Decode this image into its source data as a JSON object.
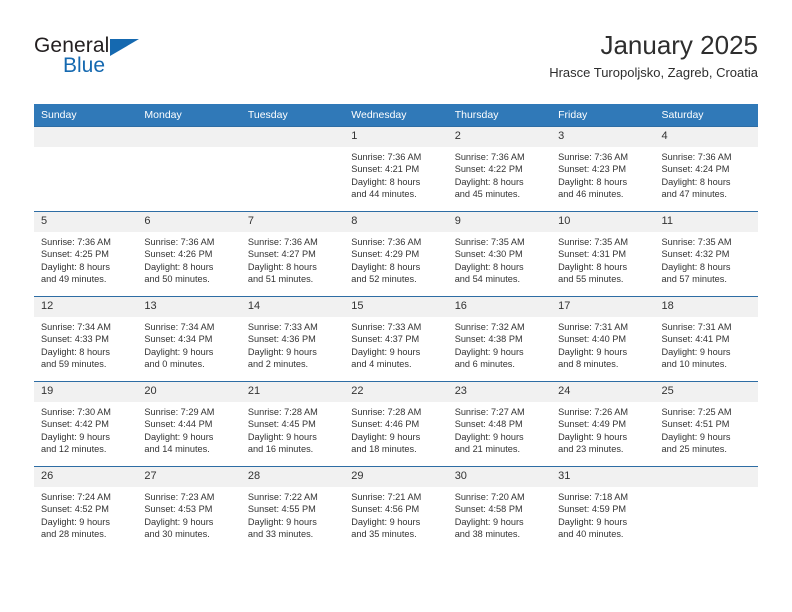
{
  "brand": {
    "name_part1": "General",
    "name_part2": "Blue",
    "triangle_color": "#1569b0"
  },
  "header": {
    "title": "January 2025",
    "subtitle": "Hrasce Turopoljsko, Zagreb, Croatia"
  },
  "theme": {
    "header_row_bg": "#3079b8",
    "header_row_text": "#ffffff",
    "daynum_bg": "#f1f1f1",
    "cell_border": "#2e6da4"
  },
  "weekdays": [
    "Sunday",
    "Monday",
    "Tuesday",
    "Wednesday",
    "Thursday",
    "Friday",
    "Saturday"
  ],
  "labels": {
    "sunrise_prefix": "Sunrise:",
    "sunset_prefix": "Sunset:",
    "daylight_prefix": "Daylight:"
  },
  "weeks": [
    [
      {
        "day": "",
        "empty": true
      },
      {
        "day": "",
        "empty": true
      },
      {
        "day": "",
        "empty": true
      },
      {
        "day": "1",
        "sunrise": "Sunrise: 7:36 AM",
        "sunset": "Sunset: 4:21 PM",
        "daylight1": "Daylight: 8 hours",
        "daylight2": "and 44 minutes."
      },
      {
        "day": "2",
        "sunrise": "Sunrise: 7:36 AM",
        "sunset": "Sunset: 4:22 PM",
        "daylight1": "Daylight: 8 hours",
        "daylight2": "and 45 minutes."
      },
      {
        "day": "3",
        "sunrise": "Sunrise: 7:36 AM",
        "sunset": "Sunset: 4:23 PM",
        "daylight1": "Daylight: 8 hours",
        "daylight2": "and 46 minutes."
      },
      {
        "day": "4",
        "sunrise": "Sunrise: 7:36 AM",
        "sunset": "Sunset: 4:24 PM",
        "daylight1": "Daylight: 8 hours",
        "daylight2": "and 47 minutes."
      }
    ],
    [
      {
        "day": "5",
        "sunrise": "Sunrise: 7:36 AM",
        "sunset": "Sunset: 4:25 PM",
        "daylight1": "Daylight: 8 hours",
        "daylight2": "and 49 minutes."
      },
      {
        "day": "6",
        "sunrise": "Sunrise: 7:36 AM",
        "sunset": "Sunset: 4:26 PM",
        "daylight1": "Daylight: 8 hours",
        "daylight2": "and 50 minutes."
      },
      {
        "day": "7",
        "sunrise": "Sunrise: 7:36 AM",
        "sunset": "Sunset: 4:27 PM",
        "daylight1": "Daylight: 8 hours",
        "daylight2": "and 51 minutes."
      },
      {
        "day": "8",
        "sunrise": "Sunrise: 7:36 AM",
        "sunset": "Sunset: 4:29 PM",
        "daylight1": "Daylight: 8 hours",
        "daylight2": "and 52 minutes."
      },
      {
        "day": "9",
        "sunrise": "Sunrise: 7:35 AM",
        "sunset": "Sunset: 4:30 PM",
        "daylight1": "Daylight: 8 hours",
        "daylight2": "and 54 minutes."
      },
      {
        "day": "10",
        "sunrise": "Sunrise: 7:35 AM",
        "sunset": "Sunset: 4:31 PM",
        "daylight1": "Daylight: 8 hours",
        "daylight2": "and 55 minutes."
      },
      {
        "day": "11",
        "sunrise": "Sunrise: 7:35 AM",
        "sunset": "Sunset: 4:32 PM",
        "daylight1": "Daylight: 8 hours",
        "daylight2": "and 57 minutes."
      }
    ],
    [
      {
        "day": "12",
        "sunrise": "Sunrise: 7:34 AM",
        "sunset": "Sunset: 4:33 PM",
        "daylight1": "Daylight: 8 hours",
        "daylight2": "and 59 minutes."
      },
      {
        "day": "13",
        "sunrise": "Sunrise: 7:34 AM",
        "sunset": "Sunset: 4:34 PM",
        "daylight1": "Daylight: 9 hours",
        "daylight2": "and 0 minutes."
      },
      {
        "day": "14",
        "sunrise": "Sunrise: 7:33 AM",
        "sunset": "Sunset: 4:36 PM",
        "daylight1": "Daylight: 9 hours",
        "daylight2": "and 2 minutes."
      },
      {
        "day": "15",
        "sunrise": "Sunrise: 7:33 AM",
        "sunset": "Sunset: 4:37 PM",
        "daylight1": "Daylight: 9 hours",
        "daylight2": "and 4 minutes."
      },
      {
        "day": "16",
        "sunrise": "Sunrise: 7:32 AM",
        "sunset": "Sunset: 4:38 PM",
        "daylight1": "Daylight: 9 hours",
        "daylight2": "and 6 minutes."
      },
      {
        "day": "17",
        "sunrise": "Sunrise: 7:31 AM",
        "sunset": "Sunset: 4:40 PM",
        "daylight1": "Daylight: 9 hours",
        "daylight2": "and 8 minutes."
      },
      {
        "day": "18",
        "sunrise": "Sunrise: 7:31 AM",
        "sunset": "Sunset: 4:41 PM",
        "daylight1": "Daylight: 9 hours",
        "daylight2": "and 10 minutes."
      }
    ],
    [
      {
        "day": "19",
        "sunrise": "Sunrise: 7:30 AM",
        "sunset": "Sunset: 4:42 PM",
        "daylight1": "Daylight: 9 hours",
        "daylight2": "and 12 minutes."
      },
      {
        "day": "20",
        "sunrise": "Sunrise: 7:29 AM",
        "sunset": "Sunset: 4:44 PM",
        "daylight1": "Daylight: 9 hours",
        "daylight2": "and 14 minutes."
      },
      {
        "day": "21",
        "sunrise": "Sunrise: 7:28 AM",
        "sunset": "Sunset: 4:45 PM",
        "daylight1": "Daylight: 9 hours",
        "daylight2": "and 16 minutes."
      },
      {
        "day": "22",
        "sunrise": "Sunrise: 7:28 AM",
        "sunset": "Sunset: 4:46 PM",
        "daylight1": "Daylight: 9 hours",
        "daylight2": "and 18 minutes."
      },
      {
        "day": "23",
        "sunrise": "Sunrise: 7:27 AM",
        "sunset": "Sunset: 4:48 PM",
        "daylight1": "Daylight: 9 hours",
        "daylight2": "and 21 minutes."
      },
      {
        "day": "24",
        "sunrise": "Sunrise: 7:26 AM",
        "sunset": "Sunset: 4:49 PM",
        "daylight1": "Daylight: 9 hours",
        "daylight2": "and 23 minutes."
      },
      {
        "day": "25",
        "sunrise": "Sunrise: 7:25 AM",
        "sunset": "Sunset: 4:51 PM",
        "daylight1": "Daylight: 9 hours",
        "daylight2": "and 25 minutes."
      }
    ],
    [
      {
        "day": "26",
        "sunrise": "Sunrise: 7:24 AM",
        "sunset": "Sunset: 4:52 PM",
        "daylight1": "Daylight: 9 hours",
        "daylight2": "and 28 minutes."
      },
      {
        "day": "27",
        "sunrise": "Sunrise: 7:23 AM",
        "sunset": "Sunset: 4:53 PM",
        "daylight1": "Daylight: 9 hours",
        "daylight2": "and 30 minutes."
      },
      {
        "day": "28",
        "sunrise": "Sunrise: 7:22 AM",
        "sunset": "Sunset: 4:55 PM",
        "daylight1": "Daylight: 9 hours",
        "daylight2": "and 33 minutes."
      },
      {
        "day": "29",
        "sunrise": "Sunrise: 7:21 AM",
        "sunset": "Sunset: 4:56 PM",
        "daylight1": "Daylight: 9 hours",
        "daylight2": "and 35 minutes."
      },
      {
        "day": "30",
        "sunrise": "Sunrise: 7:20 AM",
        "sunset": "Sunset: 4:58 PM",
        "daylight1": "Daylight: 9 hours",
        "daylight2": "and 38 minutes."
      },
      {
        "day": "31",
        "sunrise": "Sunrise: 7:18 AM",
        "sunset": "Sunset: 4:59 PM",
        "daylight1": "Daylight: 9 hours",
        "daylight2": "and 40 minutes."
      },
      {
        "day": "",
        "empty": true
      }
    ]
  ]
}
